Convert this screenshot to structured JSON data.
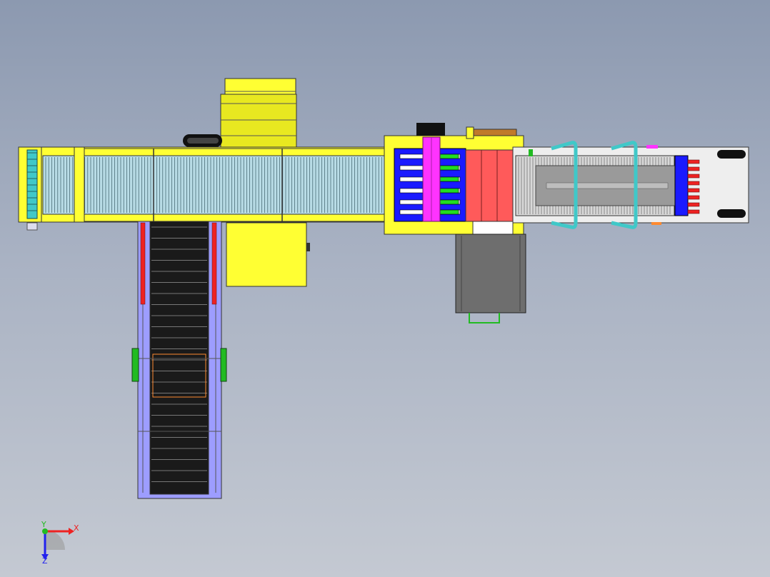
{
  "viewport": {
    "background_top": "#8c99b0",
    "background_bottom": "#c4c9d2"
  },
  "model": {
    "colors": {
      "frame_yellow": "#ffff33",
      "dark_yellow": "#cccc00",
      "belt_light": "#b8dce6",
      "belt_dark": "#1a1a1a",
      "roller_cyan": "#40c8c8",
      "side_rail_lavender": "#9d9dff",
      "hopper_blue": "#1a1aff",
      "drive_magenta": "#ff33ff",
      "guide_green": "#22dd22",
      "block_red": "#ff5a5a",
      "motor_gray": "#6e6e6e",
      "cylinder_red": "#ee2222",
      "bracket_green": "#22bb22",
      "orange_accent": "#ff8a30"
    }
  },
  "triad": {
    "x_label": "X",
    "y_label": "Y",
    "z_label": "Z",
    "x_color": "#ee2222",
    "y_color": "#22bb22",
    "z_color": "#2222ee"
  }
}
